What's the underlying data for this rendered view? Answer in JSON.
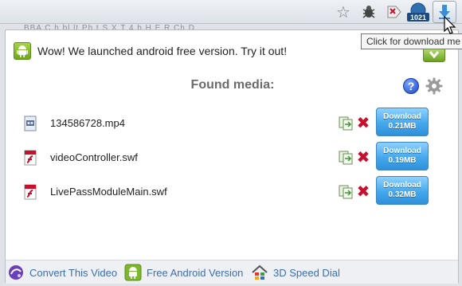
{
  "browser": {
    "bookmarks_text": "BBA  C  h  bl  lt  Ph  t  S  X T  4  b  H  E  R  Ch  D",
    "counter_badge": "1021",
    "tooltip": "Click for download me"
  },
  "popup": {
    "banner_text": "Wow! We launched android free version. Try it out!",
    "found_title": "Found media:",
    "help_label": "?",
    "items": [
      {
        "name": "134586728.mp4",
        "download_label": "Download",
        "size": "0.21MB",
        "type": "video"
      },
      {
        "name": "videoController.swf",
        "download_label": "Download",
        "size": "0.19MB",
        "type": "flash"
      },
      {
        "name": "LivePassModuleMain.swf",
        "download_label": "Download",
        "size": "0.32MB",
        "type": "flash"
      }
    ],
    "delete_glyph": "✖",
    "footer": {
      "convert": "Convert This Video",
      "android": "Free Android Version",
      "dial": "3D Speed Dial"
    }
  },
  "colors": {
    "accent_blue": "#45a8ec",
    "android_green": "#7db72f",
    "delete_red": "#c8102e",
    "link_blue": "#3b6fb2"
  }
}
